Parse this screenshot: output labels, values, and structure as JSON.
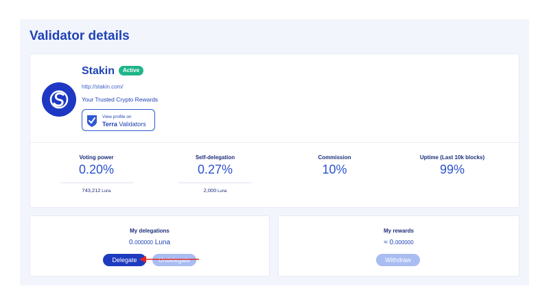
{
  "page": {
    "title": "Validator details"
  },
  "validator": {
    "name": "Stakin",
    "status": "Active",
    "url": "http://stakin.com/",
    "description": "Your Trusted Crypto Rewards",
    "avatar_icon": "stakin-logo-icon",
    "profile_button": {
      "line1": "View profile on",
      "brand": "Terra",
      "suffix": " Validators",
      "icon": "terra-shield-icon"
    }
  },
  "stats": [
    {
      "label": "Voting power",
      "value": "0.20%",
      "sub_value": "743,212",
      "sub_unit": " Luna"
    },
    {
      "label": "Self-delegation",
      "value": "0.27%",
      "sub_value": "2,000",
      "sub_unit": " Luna"
    },
    {
      "label": "Commission",
      "value": "10%"
    },
    {
      "label": "Uptime (Last 10k blocks)",
      "value": "99%"
    }
  ],
  "delegations": {
    "title": "My delegations",
    "amount_main": "0.",
    "amount_decimals": "000000",
    "amount_unit": " Luna",
    "delegate_label": "Delegate",
    "undelegate_label": "Undelegate"
  },
  "rewards": {
    "title": "My rewards",
    "amount_main": "≈ 0.",
    "amount_decimals": "000000",
    "withdraw_label": "Withdraw"
  },
  "colors": {
    "primary": "#2043b5",
    "active_badge": "#1fb58a",
    "button_primary": "#1e3bbf",
    "button_disabled": "#a9bdf3",
    "annotation_arrow": "#e02424"
  }
}
